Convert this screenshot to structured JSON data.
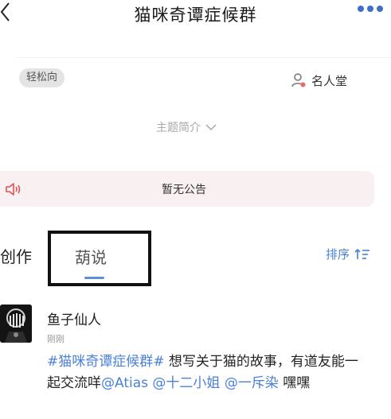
{
  "header": {
    "title": "猫咪奇谭症候群"
  },
  "group": {
    "tag": "轻松向",
    "hall_of_fame": "名人堂",
    "topic_intro": "主题简介"
  },
  "notice": {
    "text": "暂无公告"
  },
  "tabs": {
    "create": "创作",
    "hulu": "葫说",
    "sort": "排序"
  },
  "post": {
    "author": "鱼子仙人",
    "time": "刚刚",
    "hashtag": "#猫咪奇谭症候群#",
    "text1": " 想写关于猫的故事，有道友能一起交流咩",
    "mention1": "@Atias",
    "mention2": "@十二小姐",
    "mention3": "@一斥染",
    "text2": " 嘿嘿"
  },
  "colors": {
    "accent": "#4a80d8",
    "notice_bg": "#f8f0f1",
    "notice_icon": "#e05252",
    "tag_bg": "#e4e4e4"
  }
}
